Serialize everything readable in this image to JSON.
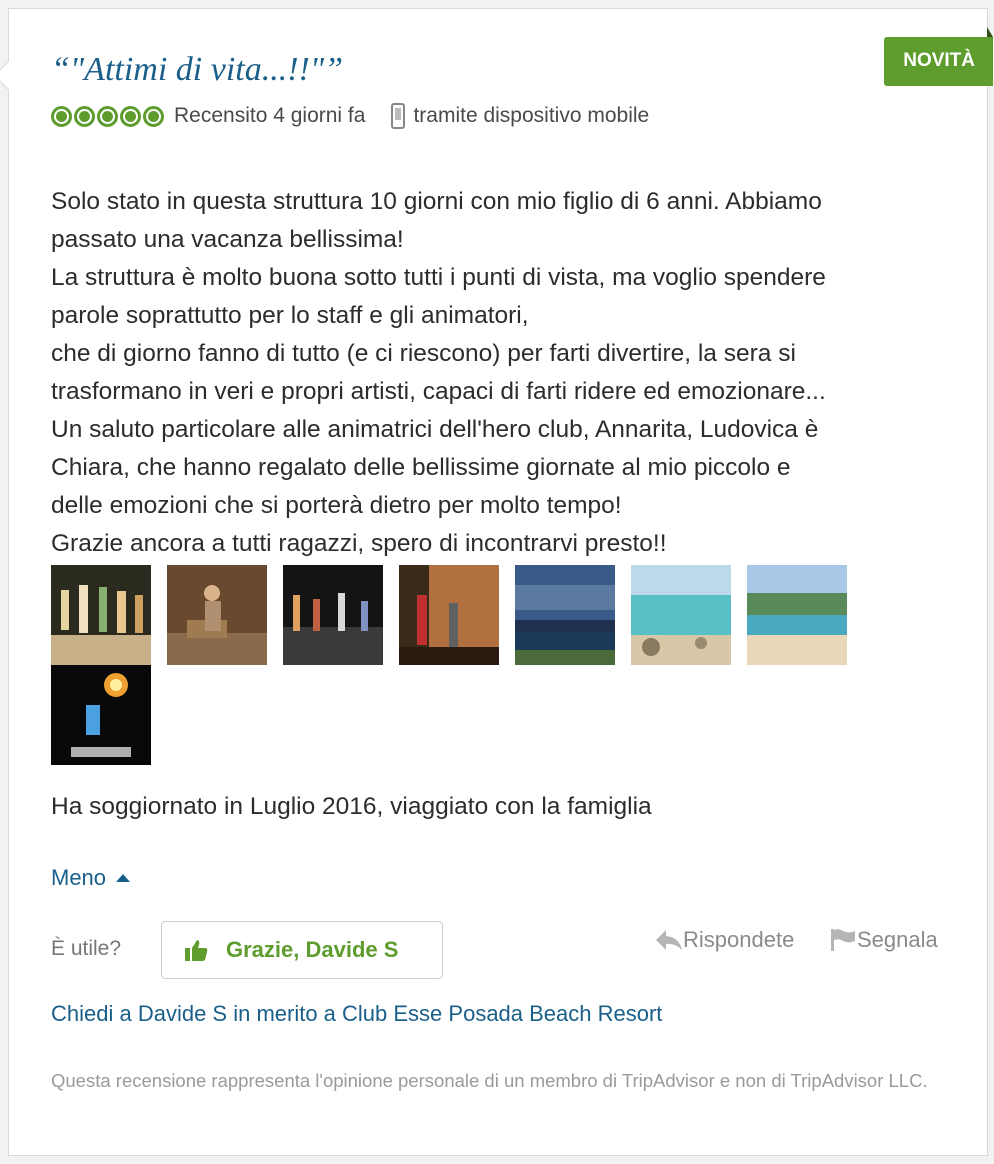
{
  "badge": "NOVITÀ",
  "title": "“\"Attimi di vita...!!\"”",
  "meta": {
    "rating": 5,
    "reviewed": "Recensito 4 giorni fa",
    "device": "tramite dispositivo mobile"
  },
  "review_lines": [
    "Solo stato in questa struttura 10 giorni con mio figlio di 6 anni. Abbiamo",
    "passato una vacanza bellissima!",
    "La struttura è molto buona sotto tutti i punti di vista, ma voglio spendere",
    "parole soprattutto per lo staff e gli animatori,",
    "che di giorno fanno di tutto (e ci riescono) per farti divertire, la sera si",
    "trasformano in veri e propri artisti, capaci di farti ridere ed emozionare...",
    "Un saluto particolare alle animatrici dell'hero club, Annarita, Ludovica è",
    "Chiara, che hanno regalato delle bellissime giornate al mio piccolo e",
    "delle emozioni che si porterà dietro per molto tempo!",
    "Grazie ancora a tutti ragazzi, spero di incontrarvi presto!!"
  ],
  "stay": "Ha soggiornato in Luglio 2016, viaggiato con la famiglia",
  "less_label": "Meno",
  "useful_label": "È utile?",
  "thanks_label": "Grazie, Davide S",
  "reply_label": "Rispondete",
  "flag_label": "Segnala",
  "ask_link": "Chiedi a Davide S in merito a Club Esse Posada Beach Resort",
  "disclaimer": "Questa recensione rappresenta l'opinione personale di un membro di TripAdvisor e non di TripAdvisor LLC.",
  "colors": {
    "accent_green": "#5e9c2e",
    "link_blue": "#1a5f8a"
  }
}
